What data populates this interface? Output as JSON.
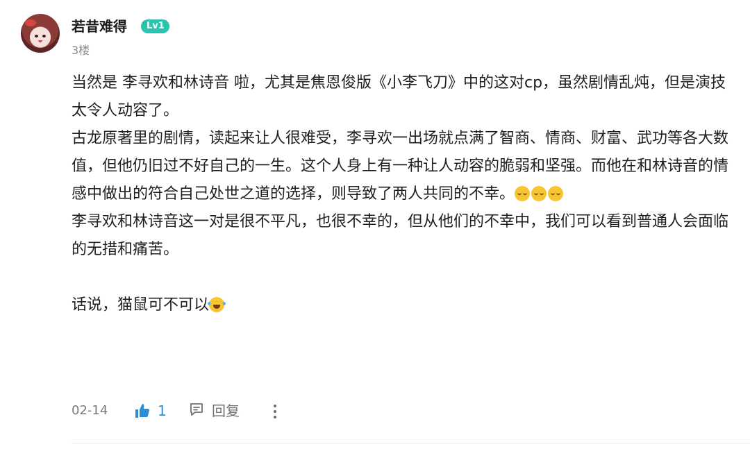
{
  "post": {
    "author": {
      "name": "若昔难得",
      "level": "Lv1",
      "avatar_icon": "anime-girl-avatar"
    },
    "floor": "3楼",
    "content": {
      "p1": "当然是 李寻欢和林诗音 啦，尤其是焦恩俊版《小李飞刀》中的这对cp，虽然剧情乱炖，但是演技太令人动容了。",
      "p2": "古龙原著里的剧情，读起来让人很难受，李寻欢一出场就点满了智商、情商、财富、武功等各大数值，但他仍旧过不好自己的一生。这个人身上有一种让人动容的脆弱和坚强。而他在和林诗音的情感中做出的符合自己处世之道的选择，则导致了两人共同的不幸。",
      "p2_emojis": [
        "relieved-face-emoji",
        "relieved-face-emoji",
        "relieved-face-emoji"
      ],
      "p3": "李寻欢和林诗音这一对是很不平凡，也很不幸的，但从他们的不幸中，我们可以看到普通人会面临的无措和痛苦。",
      "p4": "话说，猫鼠可不可以",
      "p4_emoji": "tears-of-joy-emoji"
    },
    "footer": {
      "date": "02-14",
      "like_icon": "thumbs-up-icon",
      "like_count": "1",
      "reply_icon": "comment-icon",
      "reply_label": "回复",
      "more_icon": "more-vertical-icon"
    },
    "colors": {
      "level_badge": "#27c5ae",
      "like_accent": "#2b8fd6",
      "muted_text": "#8c8c8c"
    }
  }
}
